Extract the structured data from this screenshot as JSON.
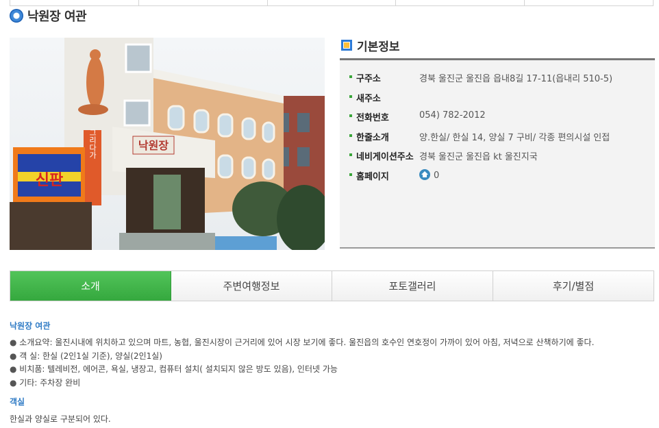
{
  "page_title": "낙원장 여관",
  "info": {
    "heading": "기본정보",
    "rows": [
      {
        "key": "구주소",
        "value": "경북 울진군 울진읍 읍내8길 17-11(읍내리 510-5)"
      },
      {
        "key": "새주소",
        "value": ""
      },
      {
        "key": "전화번호",
        "value": "054) 782-2012"
      },
      {
        "key": "한줄소개",
        "value": "양.한실/ 한실 14, 양실 7 구비/ 각종 편의시설 인접"
      },
      {
        "key": "네비게이션주소",
        "value": "경북 울진군 울진읍 kt 울진지국"
      },
      {
        "key": "홈페이지",
        "value": "0"
      }
    ]
  },
  "tabs": [
    "소개",
    "주변여행정보",
    "포토갤러리",
    "후기/별점"
  ],
  "active_tab": "소개",
  "intro": {
    "title": "낙원장 여관",
    "bullets": [
      "소개요약: 울진시내에 위치하고 있으며 마트, 농협, 울진시장이 근거리에 있어 시장 보기에 좋다. 울진읍의 호수인 연호정이 가까이 있어 아침, 저녁으로 산책하기에 좋다.",
      "객 실: 한실 (2인1실 기준), 양실(2인1실)",
      "비치품: 텔레비전, 에어콘, 욕실, 냉장고, 컴퓨터 설치( 설치되지 않은 방도 있음), 인터넷 가능",
      "기타: 주차장 완비"
    ]
  },
  "rooms": {
    "title": "객실",
    "text": "한실과 양실로 구분되어 있다."
  },
  "photo_sign": {
    "left_sign": "신판",
    "vertical_sign": "그리다가",
    "building_sign": "낙원장"
  },
  "colors": {
    "active_tab": "#3fb648",
    "section_title": "#2f7bc5",
    "bullet_green": "#3aa53a"
  }
}
